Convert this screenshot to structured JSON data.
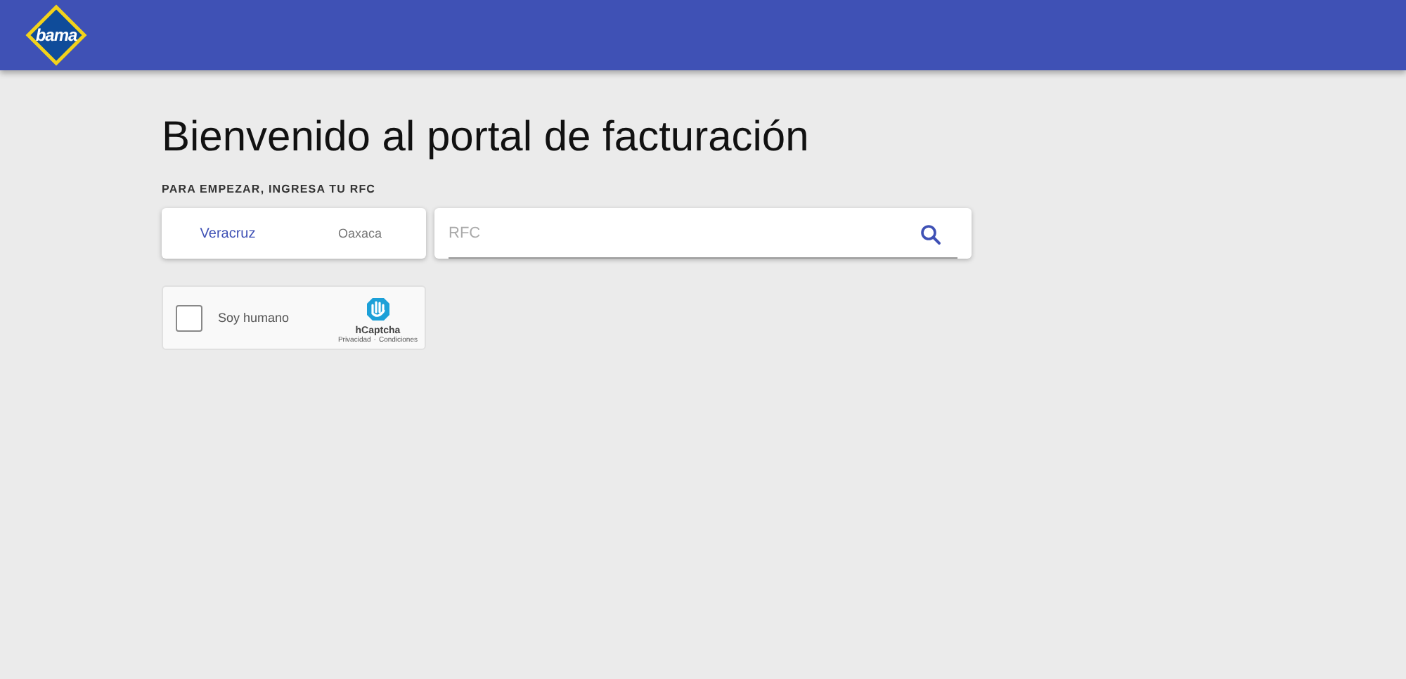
{
  "header": {
    "logo_text": "bama"
  },
  "title": "Bienvenido al portal de facturación",
  "prompt": "PARA EMPEZAR, INGRESA TU RFC",
  "tabs": [
    {
      "label": "Veracruz",
      "selected": true
    },
    {
      "label": "Oaxaca",
      "selected": false
    }
  ],
  "search": {
    "placeholder": "RFC"
  },
  "captcha": {
    "label": "Soy humano",
    "checked": false,
    "brand": "hCaptcha",
    "links": [
      "Privacidad",
      "Condiciones"
    ],
    "separator": "·"
  }
}
